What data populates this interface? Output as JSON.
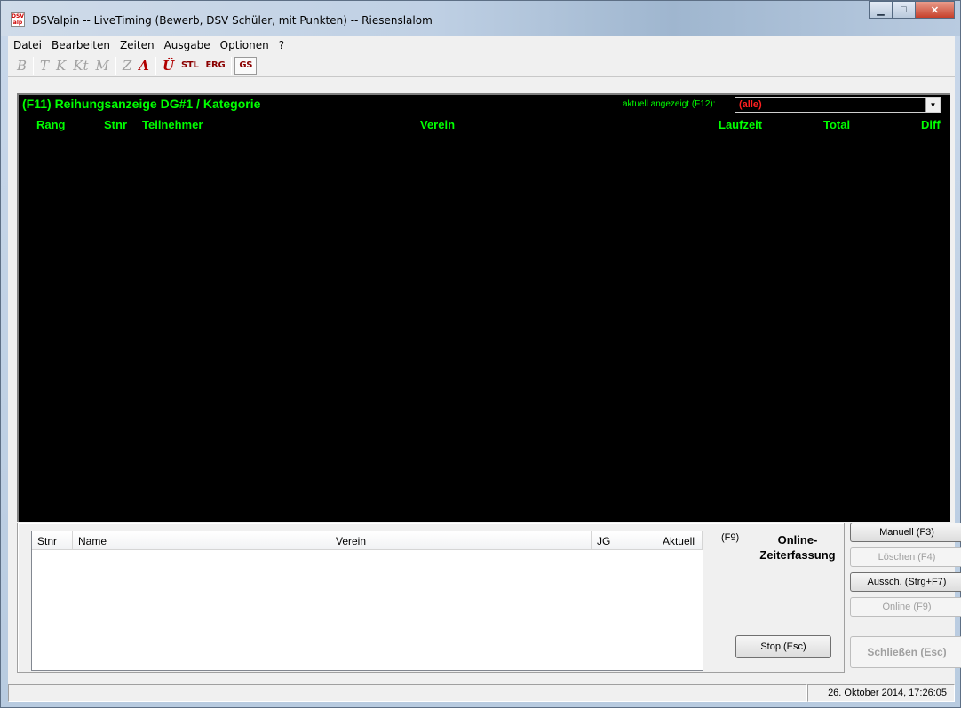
{
  "window": {
    "title": "DSValpin -- LiveTiming (Bewerb, DSV Schüler, mit Punkten) -- Riesenslalom",
    "app_icon_text": "DSV alpin"
  },
  "menu": [
    "Datei",
    "Bearbeiten",
    "Zeiten",
    "Ausgabe",
    "Optionen",
    "?"
  ],
  "toolbar": {
    "b": "B",
    "t": "T",
    "k": "K",
    "kt": "Kt",
    "m": "M",
    "z": "Z",
    "a": "A",
    "u": "Ü",
    "stl": "STL",
    "erg": "ERG",
    "gs": "GS"
  },
  "ranking": {
    "title": "(F11)  Reihungsanzeige DG#1 / Kategorie",
    "current_label": "aktuell angezeigt (F12):",
    "current_value": "(alle)",
    "columns": {
      "rang": "Rang",
      "stnr": "Stnr",
      "teilnehmer": "Teilnehmer",
      "verein": "Verein",
      "laufzeit": "Laufzeit",
      "total": "Total",
      "diff": "Diff"
    }
  },
  "grid": {
    "columns": [
      "Stnr",
      "Name",
      "Verein",
      "JG",
      "Aktuell"
    ]
  },
  "online": {
    "key": "(F9)",
    "title": "Online-\nZeiterfassung",
    "stop": "Stop (Esc)"
  },
  "side_buttons": {
    "manuell": "Manuell (F3)",
    "loeschen": "Löschen (F4)",
    "aussch": "Aussch. (Strg+F7)",
    "online": "Online (F9)",
    "schliessen": "Schließen (Esc)"
  },
  "status": {
    "datetime": "26. Oktober 2014, 17:26:05"
  }
}
